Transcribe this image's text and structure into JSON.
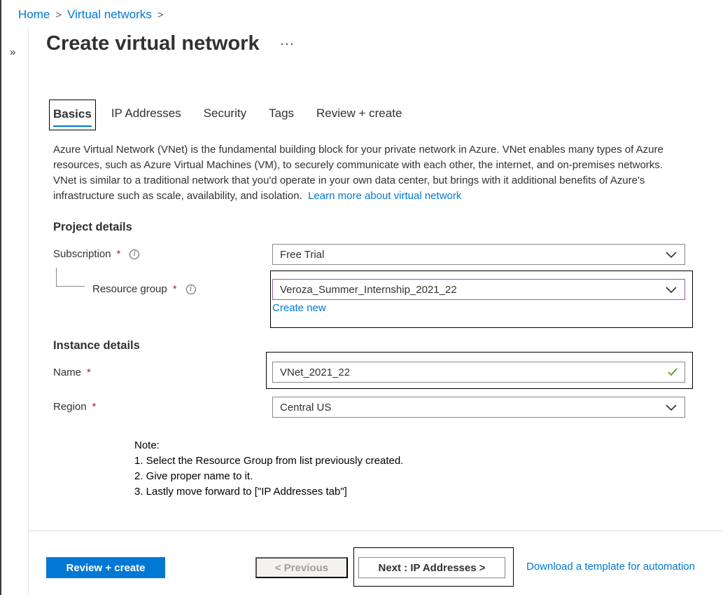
{
  "breadcrumb": {
    "home": "Home",
    "sep1": ">",
    "current": "Virtual networks",
    "sep2": ">"
  },
  "nav": {
    "collapse_glyph": "»"
  },
  "page": {
    "title": "Create virtual network",
    "more": "···"
  },
  "tabs": [
    {
      "label": "Basics",
      "active": true
    },
    {
      "label": "IP Addresses",
      "active": false
    },
    {
      "label": "Security",
      "active": false
    },
    {
      "label": "Tags",
      "active": false
    },
    {
      "label": "Review + create",
      "active": false
    }
  ],
  "description": {
    "text": "Azure Virtual Network (VNet) is the fundamental building block for your private network in Azure. VNet enables many types of Azure resources, such as Azure Virtual Machines (VM), to securely communicate with each other, the internet, and on-premises networks. VNet is similar to a traditional network that you'd operate in your own data center, but brings with it additional benefits of Azure's infrastructure such as scale, availability, and isolation.",
    "link": "Learn more about virtual network"
  },
  "project_details": {
    "header": "Project details",
    "subscription": {
      "label": "Subscription",
      "required": "*",
      "info": "i",
      "value": "Free Trial"
    },
    "resource_group": {
      "label": "Resource group",
      "required": "*",
      "info": "i",
      "value": "Veroza_Summer_Internship_2021_22",
      "create_new": "Create new"
    }
  },
  "instance_details": {
    "header": "Instance details",
    "name": {
      "label": "Name",
      "required": "*",
      "value": "VNet_2021_22"
    },
    "region": {
      "label": "Region",
      "required": "*",
      "value": "Central US"
    }
  },
  "note": {
    "title": "Note:",
    "lines": [
      "1. Select the Resource Group from list previously created.",
      "2. Give proper name to it.",
      "3. Lastly move forward to [\"IP Addresses tab\"]"
    ]
  },
  "footer": {
    "review_create": "Review + create",
    "previous": "< Previous",
    "next": "Next : IP Addresses >",
    "download": "Download a template for automation"
  },
  "colors": {
    "accent": "#0078d4",
    "required": "#a4262c",
    "valid": "#57a300",
    "focus": "#8a5fbf"
  }
}
